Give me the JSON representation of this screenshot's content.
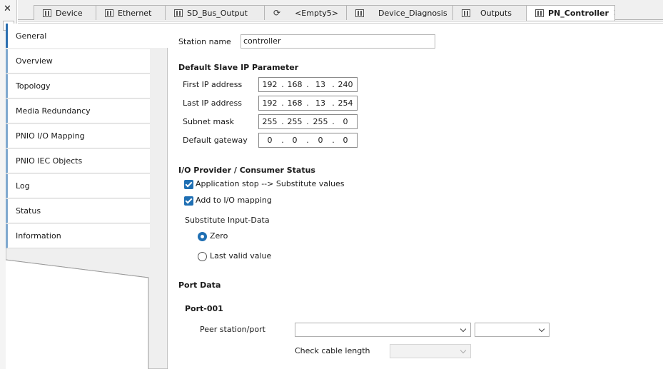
{
  "tabs": [
    {
      "label": "Device",
      "icon": "device-icon"
    },
    {
      "label": "Ethernet",
      "icon": "device-icon"
    },
    {
      "label": "SD_Bus_Output",
      "icon": "bus-icon"
    },
    {
      "label": "<Empty5>",
      "icon": "slot-icon"
    },
    {
      "label": "Device_Diagnosis",
      "icon": "device-icon"
    },
    {
      "label": "Outputs",
      "icon": "bus-icon"
    },
    {
      "label": "PN_Controller",
      "icon": "device-icon",
      "active": true
    }
  ],
  "sidebar": {
    "items": [
      {
        "label": "General",
        "active": true
      },
      {
        "label": "Overview"
      },
      {
        "label": "Topology"
      },
      {
        "label": "Media Redundancy"
      },
      {
        "label": "PNIO I/O Mapping"
      },
      {
        "label": "PNIO IEC Objects"
      },
      {
        "label": "Log"
      },
      {
        "label": "Status"
      },
      {
        "label": "Information"
      }
    ]
  },
  "general": {
    "station_name_label": "Station name",
    "station_name_value": "controller",
    "ip_section_title": "Default Slave IP Parameter",
    "first_ip_label": "First IP address",
    "first_ip": [
      "192",
      "168",
      "13",
      "240"
    ],
    "last_ip_label": "Last IP address",
    "last_ip": [
      "192",
      "168",
      "13",
      "254"
    ],
    "subnet_label": "Subnet mask",
    "subnet": [
      "255",
      "255",
      "255",
      "0"
    ],
    "gateway_label": "Default gateway",
    "gateway": [
      "0",
      "0",
      "0",
      "0"
    ],
    "io_section_title": "I/O Provider / Consumer Status",
    "app_stop_label": "Application stop --> Substitute values",
    "app_stop_checked": true,
    "add_mapping_label": "Add to I/O mapping",
    "add_mapping_checked": true,
    "substitute_label": "Substitute Input-Data",
    "radio_zero_label": "Zero",
    "radio_last_label": "Last valid value",
    "radio_selected": "Zero",
    "port_section_title": "Port Data",
    "port_name": "Port-001",
    "peer_label": "Peer station/port",
    "cable_label": "Check cable length"
  },
  "colors": {
    "accent": "#1f6fb3",
    "nav_marker": "#7fa9cf"
  }
}
